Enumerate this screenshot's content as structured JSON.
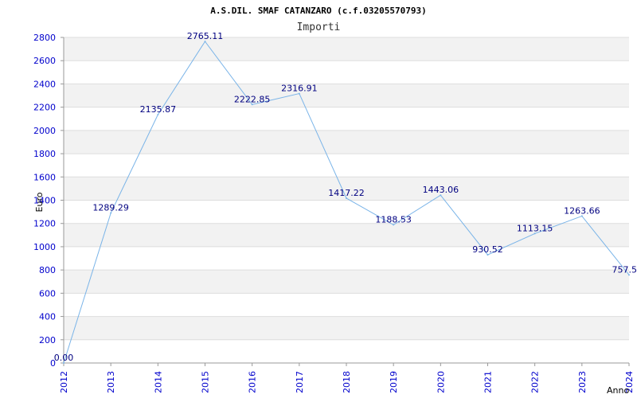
{
  "chart_data": {
    "type": "line",
    "title": "A.S.DIL. SMAF CATANZARO (c.f.03205570793)",
    "subtitle": "Importi",
    "xlabel": "Anno",
    "ylabel": "Euro",
    "categories": [
      "2012",
      "2013",
      "2014",
      "2015",
      "2016",
      "2017",
      "2018",
      "2019",
      "2020",
      "2021",
      "2022",
      "2023",
      "2024"
    ],
    "values": [
      0.0,
      1289.29,
      2135.87,
      2765.11,
      2222.85,
      2316.91,
      1417.22,
      1188.53,
      1443.06,
      930.52,
      1113.15,
      1263.66,
      757.5
    ],
    "value_labels": [
      "0.00",
      "1289.29",
      "2135.87",
      "2765.11",
      "2222.85",
      "2316.91",
      "1417.22",
      "1188.53",
      "1443.06",
      "930.52",
      "1113.15",
      "1263.66",
      "757.5"
    ],
    "yticks": [
      0,
      200,
      400,
      600,
      800,
      1000,
      1200,
      1400,
      1600,
      1800,
      2000,
      2200,
      2400,
      2600,
      2800
    ],
    "ylim": [
      0,
      2800
    ],
    "grid": true,
    "colors": {
      "line": "#7ab4e8",
      "tick_text": "#0000cc",
      "label_text": "#000080",
      "band": "#f2f2f2",
      "gridline": "#dddddd"
    }
  }
}
